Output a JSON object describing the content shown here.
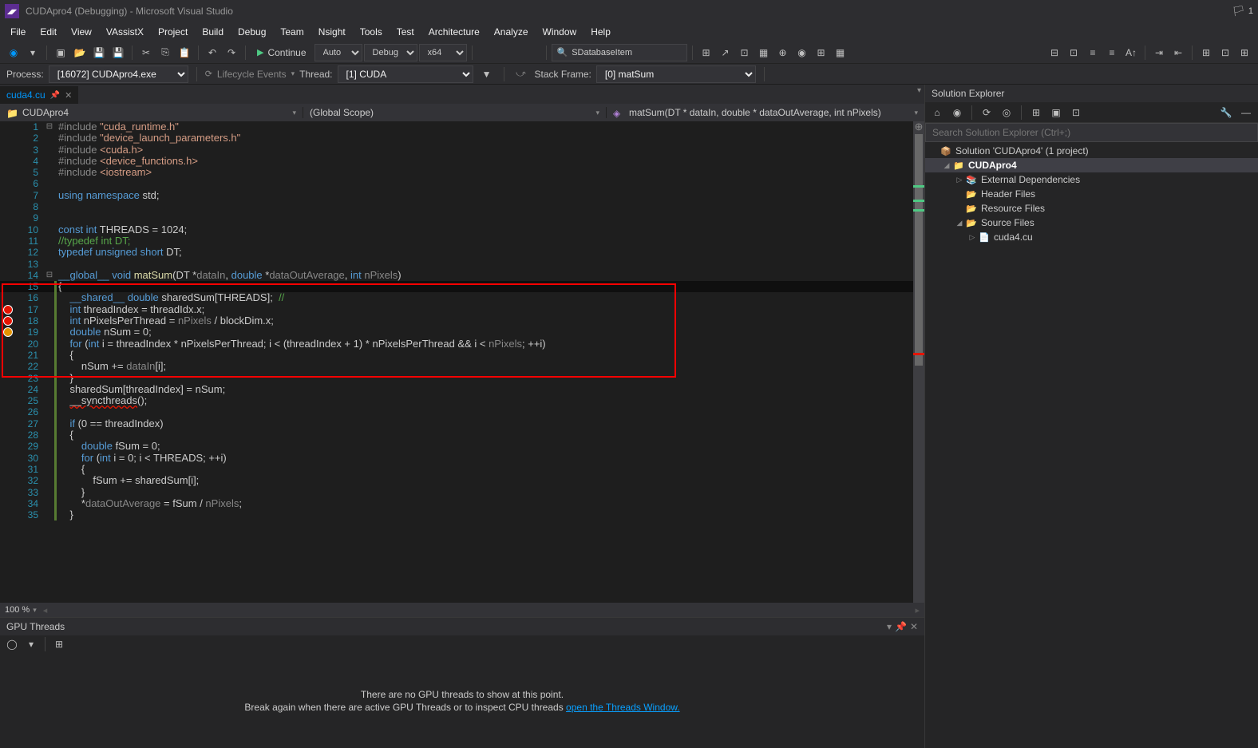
{
  "titlebar": {
    "title": "CUDApro4 (Debugging) - Microsoft Visual Studio",
    "flag_badge": "1"
  },
  "menu": {
    "items": [
      "File",
      "Edit",
      "View",
      "VAssistX",
      "Project",
      "Build",
      "Debug",
      "Team",
      "Nsight",
      "Tools",
      "Test",
      "Architecture",
      "Analyze",
      "Window",
      "Help"
    ]
  },
  "toolbar": {
    "continue_label": "Continue",
    "config_auto": "Auto",
    "config_debug": "Debug",
    "config_platform": "x64",
    "search_item": "SDatabaseItem"
  },
  "debugbar": {
    "process_label": "Process:",
    "process_value": "[16072] CUDApro4.exe",
    "lifecycle_label": "Lifecycle Events",
    "thread_label": "Thread:",
    "thread_value": "[1] CUDA",
    "stack_label": "Stack Frame:",
    "stack_value": "[0] matSum"
  },
  "tab": {
    "name": "cuda4.cu"
  },
  "navbar": {
    "seg1": "CUDApro4",
    "seg2": "(Global Scope)",
    "seg3": "matSum(DT * dataIn, double * dataOutAverage, int nPixels)"
  },
  "code": [
    {
      "n": 1,
      "fold": "⊟",
      "g": 0,
      "html": "<span class='c-gray'>#include</span> <span class='c-str'>\"cuda_runtime.h\"</span>"
    },
    {
      "n": 2,
      "fold": "",
      "g": 0,
      "html": "<span class='c-gray'>#include</span> <span class='c-str'>\"device_launch_parameters.h\"</span>"
    },
    {
      "n": 3,
      "fold": "",
      "g": 0,
      "html": "<span class='c-gray'>#include</span> <span class='c-str'>&lt;cuda.h&gt;</span>"
    },
    {
      "n": 4,
      "fold": "",
      "g": 0,
      "html": "<span class='c-gray'>#include</span> <span class='c-str'>&lt;device_functions.h&gt;</span>"
    },
    {
      "n": 5,
      "fold": "",
      "g": 0,
      "html": "<span class='c-gray'>#include</span> <span class='c-str'>&lt;iostream&gt;</span>"
    },
    {
      "n": 6,
      "fold": "",
      "g": 0,
      "html": ""
    },
    {
      "n": 7,
      "fold": "",
      "g": 0,
      "html": "<span class='c-kw'>using namespace</span> std;"
    },
    {
      "n": 8,
      "fold": "",
      "g": 0,
      "html": ""
    },
    {
      "n": 9,
      "fold": "",
      "g": 0,
      "html": ""
    },
    {
      "n": 10,
      "fold": "",
      "g": 0,
      "html": "<span class='c-kw'>const int</span> THREADS = 1024;"
    },
    {
      "n": 11,
      "fold": "",
      "g": 0,
      "html": "<span class='c-cmt'>//typedef int DT;</span>"
    },
    {
      "n": 12,
      "fold": "",
      "g": 0,
      "html": "<span class='c-kw'>typedef unsigned short</span> DT;"
    },
    {
      "n": 13,
      "fold": "",
      "g": 0,
      "html": ""
    },
    {
      "n": 14,
      "fold": "⊟",
      "g": 0,
      "html": "<span class='c-kw'>__global__ void</span> <span class='c-fn'>matSum</span>(DT *<span class='c-gray'>dataIn</span>, <span class='c-kw'>double</span> *<span class='c-gray'>dataOutAverage</span>, <span class='c-kw'>int</span> <span class='c-gray'>nPixels</span>)"
    },
    {
      "n": 15,
      "fold": "",
      "g": 1,
      "html": "{",
      "hl": 1
    },
    {
      "n": 16,
      "fold": "",
      "g": 1,
      "html": "    <span class='c-kw'>__shared__ double</span> sharedSum[THREADS];  <span class='c-cmt'>//</span>"
    },
    {
      "n": 17,
      "fold": "",
      "g": 1,
      "html": "    <span class='c-kw'>int</span> threadIndex = threadIdx.x;",
      "bp": "bp"
    },
    {
      "n": 18,
      "fold": "",
      "g": 1,
      "html": "    <span class='c-kw'>int</span> nPixelsPerThread = <span class='c-gray'>nPixels</span> / blockDim.x;",
      "bp": "bp"
    },
    {
      "n": 19,
      "fold": "",
      "g": 1,
      "html": "    <span class='c-kw'>double</span> nSum = 0;",
      "bp": "arrow"
    },
    {
      "n": 20,
      "fold": "",
      "g": 1,
      "html": "    <span class='c-kw'>for</span> (<span class='c-kw'>int</span> i = threadIndex * nPixelsPerThread; i &lt; (threadIndex + 1) * nPixelsPerThread &amp;&amp; i &lt; <span class='c-gray'>nPixels</span>; ++i)"
    },
    {
      "n": 21,
      "fold": "",
      "g": 1,
      "html": "    {"
    },
    {
      "n": 22,
      "fold": "",
      "g": 1,
      "html": "        nSum += <span class='c-gray'>dataIn</span>[i];"
    },
    {
      "n": 23,
      "fold": "",
      "g": 1,
      "html": "    }"
    },
    {
      "n": 24,
      "fold": "",
      "g": 1,
      "html": "    sharedSum[threadIndex] = nSum;"
    },
    {
      "n": 25,
      "fold": "",
      "g": 1,
      "html": "    <span style='text-decoration: underline wavy #e51400;'>__syncthreads</span>();"
    },
    {
      "n": 26,
      "fold": "",
      "g": 1,
      "html": ""
    },
    {
      "n": 27,
      "fold": "",
      "g": 1,
      "html": "    <span class='c-kw'>if</span> (0 == threadIndex)"
    },
    {
      "n": 28,
      "fold": "",
      "g": 1,
      "html": "    {"
    },
    {
      "n": 29,
      "fold": "",
      "g": 1,
      "html": "        <span class='c-kw'>double</span> fSum = 0;"
    },
    {
      "n": 30,
      "fold": "",
      "g": 1,
      "html": "        <span class='c-kw'>for</span> (<span class='c-kw'>int</span> i = 0; i &lt; THREADS; ++i)"
    },
    {
      "n": 31,
      "fold": "",
      "g": 1,
      "html": "        {"
    },
    {
      "n": 32,
      "fold": "",
      "g": 1,
      "html": "            fSum += sharedSum[i];"
    },
    {
      "n": 33,
      "fold": "",
      "g": 1,
      "html": "        }"
    },
    {
      "n": 34,
      "fold": "",
      "g": 1,
      "html": "        *<span class='c-gray'>dataOutAverage</span> = fSum / <span class='c-gray'>nPixels</span>;"
    },
    {
      "n": 35,
      "fold": "",
      "g": 1,
      "html": "    }"
    }
  ],
  "editor_footer": {
    "zoom": "100 %"
  },
  "bottom_panel": {
    "title": "GPU Threads",
    "msg1": "There are no GPU threads to show at this point.",
    "msg2a": "Break again when there are active GPU Threads or to inspect CPU threads  ",
    "msg2b": "open the Threads Window."
  },
  "solution_explorer": {
    "title": "Solution Explorer",
    "search_placeholder": "Search Solution Explorer (Ctrl+;)",
    "tree": [
      {
        "indent": 0,
        "arrow": "",
        "icon": "📦",
        "label": "Solution 'CUDApro4' (1 project)"
      },
      {
        "indent": 1,
        "arrow": "◢",
        "icon": "📁",
        "label": "CUDApro4",
        "bold": true,
        "sel": true
      },
      {
        "indent": 2,
        "arrow": "▷",
        "icon": "📚",
        "label": "External Dependencies"
      },
      {
        "indent": 2,
        "arrow": "",
        "icon": "📂",
        "label": "Header Files"
      },
      {
        "indent": 2,
        "arrow": "",
        "icon": "📂",
        "label": "Resource Files"
      },
      {
        "indent": 2,
        "arrow": "◢",
        "icon": "📂",
        "label": "Source Files"
      },
      {
        "indent": 3,
        "arrow": "▷",
        "icon": "📄",
        "label": "cuda4.cu"
      }
    ]
  }
}
